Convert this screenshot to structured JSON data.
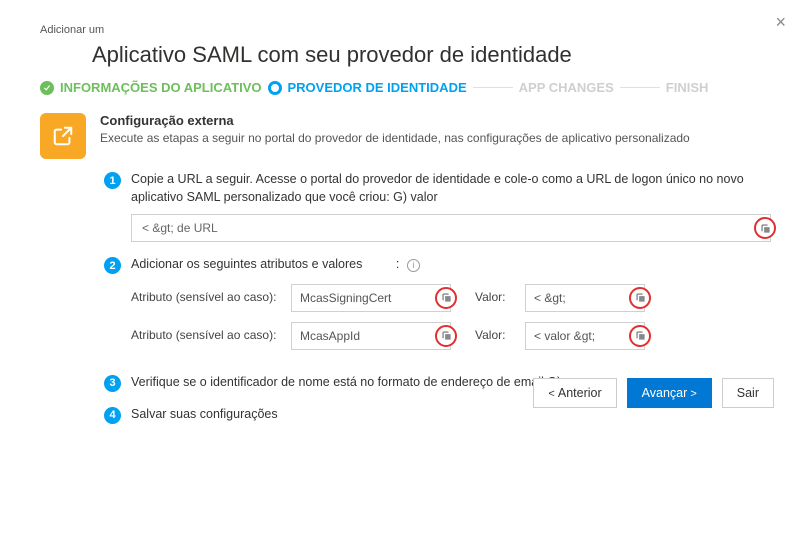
{
  "close_label": "×",
  "breadcrumb": "Adicionar um",
  "title": "Aplicativo SAML com seu provedor de identidade",
  "wizard": {
    "step1": "INFORMAÇÕES DO APLICATIVO",
    "step2": "PROVEDOR DE IDENTIDADE",
    "step3": "APP CHANGES",
    "step4": "FINISH"
  },
  "section": {
    "title": "Configuração externa",
    "desc": "Execute as etapas a seguir no portal do provedor de identidade, nas configurações de aplicativo personalizado"
  },
  "step1": {
    "num": "1",
    "text": "Copie a URL a seguir. Acesse o portal do provedor de identidade e cole-o como a URL de logon único no novo aplicativo SAML personalizado que você criou: G) valor",
    "url_value": "< &gt; de URL"
  },
  "step2": {
    "num": "2",
    "text": "Adicionar os seguintes atributos e valores",
    "colon": ":",
    "attr_label": "Atributo (sensível ao caso):",
    "val_label": "Valor:",
    "row1": {
      "attr": "McasSigningCert",
      "val": "< &gt;"
    },
    "row2": {
      "attr": "McasAppId",
      "val": "< valor &gt;"
    }
  },
  "step3": {
    "num": "3",
    "text": "Verifique se o identificador de nome está no formato de endereço de email G)"
  },
  "step4": {
    "num": "4",
    "text": "Salvar suas configurações"
  },
  "footer": {
    "prev": "Anterior",
    "next": "Avançar",
    "exit": "Sair"
  }
}
